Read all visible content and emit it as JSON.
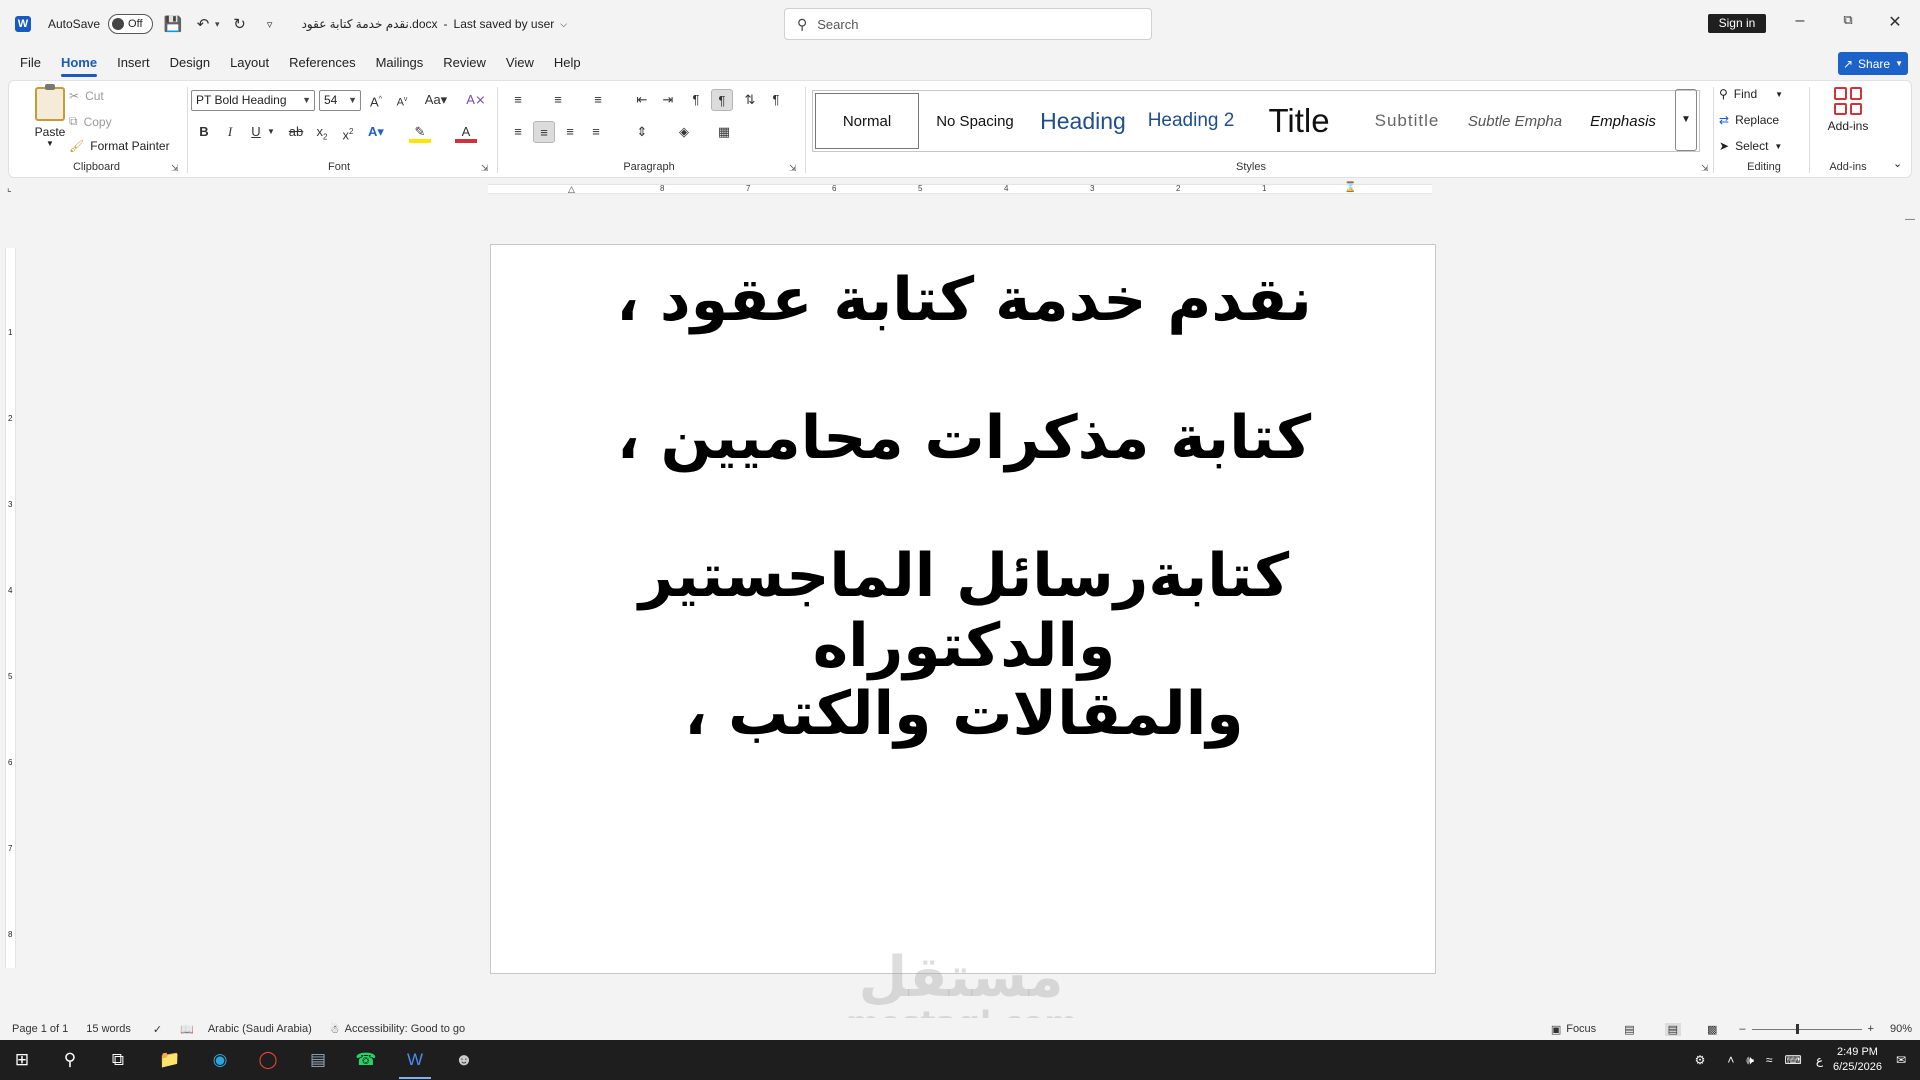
{
  "app": {
    "autosave_label": "AutoSave",
    "autosave_state": "Off",
    "doc_title": "نقدم خدمة كتابة عقود.docx",
    "save_status": "Last saved by user",
    "search_placeholder": "Search",
    "signin_label": "Sign in",
    "share_label": "Share"
  },
  "tabs": [
    "File",
    "Home",
    "Insert",
    "Design",
    "Layout",
    "References",
    "Mailings",
    "Review",
    "View",
    "Help"
  ],
  "ribbon": {
    "clipboard": {
      "paste": "Paste",
      "cut": "Cut",
      "copy": "Copy",
      "format_painter": "Format Painter",
      "label": "Clipboard"
    },
    "font": {
      "name": "PT Bold Heading",
      "size": "54",
      "label": "Font"
    },
    "paragraph": {
      "label": "Paragraph"
    },
    "styles": {
      "label": "Styles",
      "items": [
        "Normal",
        "No Spacing",
        "Heading",
        "Heading 2",
        "Title",
        "Subtitle",
        "Subtle Empha",
        "Emphasis"
      ]
    },
    "editing": {
      "find": "Find",
      "replace": "Replace",
      "select": "Select",
      "label": "Editing"
    },
    "addins": {
      "button": "Add-ins",
      "label": "Add-ins"
    }
  },
  "ruler_numbers": [
    "8",
    "7",
    "6",
    "5",
    "4",
    "3",
    "2",
    "1"
  ],
  "vruler_numbers": [
    "1",
    "2",
    "3",
    "4",
    "5",
    "6",
    "7",
    "8"
  ],
  "document": {
    "lines": [
      "نقدم خدمة كتابة عقود ،",
      "كتابة مذكرات محاميين ،",
      "كتابةرسائل الماجستير والدكتوراه",
      "والمقالات والكتب ،"
    ]
  },
  "watermark": {
    "arabic": "مستقل",
    "latin": "mostaql.com"
  },
  "status": {
    "page": "Page 1 of 1",
    "words": "15 words",
    "language": "Arabic (Saudi Arabia)",
    "accessibility": "Accessibility: Good to go",
    "focus": "Focus",
    "zoom": "90%"
  },
  "taskbar": {
    "ime": "ع",
    "time": "2:49 PM",
    "date": "6/25/2026"
  }
}
